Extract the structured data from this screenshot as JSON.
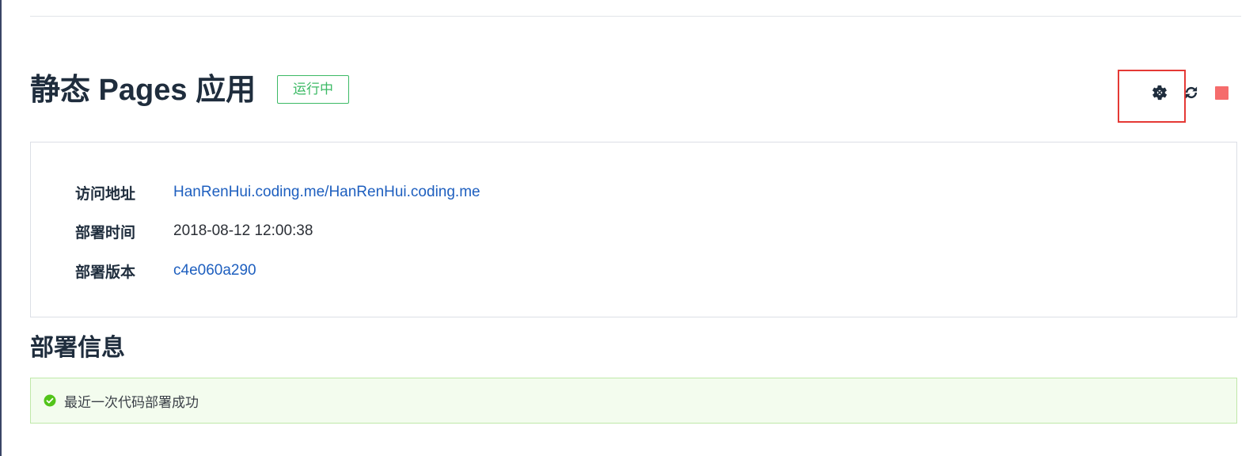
{
  "header": {
    "title": "静态 Pages 应用",
    "status_badge": "运行中"
  },
  "toolbar": {
    "settings_icon": "gear-icon",
    "refresh_icon": "refresh-icon",
    "stop_icon": "stop-icon"
  },
  "info": {
    "rows": [
      {
        "label": "访问地址",
        "value": "HanRenHui.coding.me/HanRenHui.coding.me"
      },
      {
        "label": "部署时间",
        "value": "2018-08-12 12:00:38"
      },
      {
        "label": "部署版本",
        "value": "c4e060a290"
      }
    ]
  },
  "deploy": {
    "section_title": "部署信息",
    "message": "最近一次代码部署成功"
  },
  "colors": {
    "running": "#3cba65",
    "stop": "#f56c6c",
    "link": "#1e5fbf",
    "success_bg": "#f3fcee",
    "highlight": "#e53935"
  }
}
